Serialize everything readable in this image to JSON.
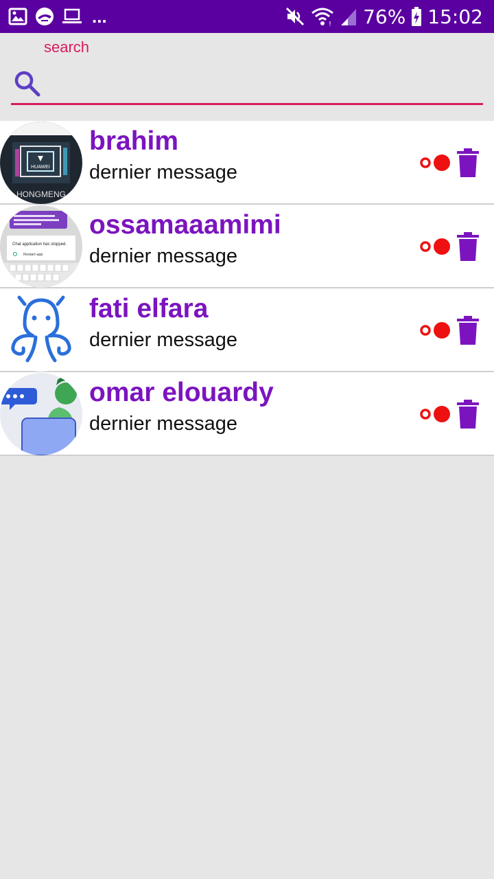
{
  "status_bar": {
    "battery": "76%",
    "time": "15:02",
    "more": "..."
  },
  "search": {
    "label": "search",
    "value": "",
    "placeholder": ""
  },
  "colors": {
    "status_bar_bg": "#5a00a0",
    "accent": "#d81b60",
    "name_color": "#7b14bf",
    "status_red": "#ee1111",
    "delete_icon": "#7b14bf"
  },
  "contacts": [
    {
      "name": "brahim",
      "message": "dernier message",
      "avatar": "huawei-hongmeng-avatar",
      "avatar_text": "HUAWEI HONGMENG"
    },
    {
      "name": "ossamaaamimi",
      "message": "dernier message",
      "avatar": "screenshot-avatar",
      "avatar_text": "Chat application has stopped. Restart app"
    },
    {
      "name": "fati elfara",
      "message": "dernier message",
      "avatar": "octopus-avatar"
    },
    {
      "name": "omar elouardy",
      "message": "dernier message",
      "avatar": "person-chat-avatar"
    }
  ]
}
